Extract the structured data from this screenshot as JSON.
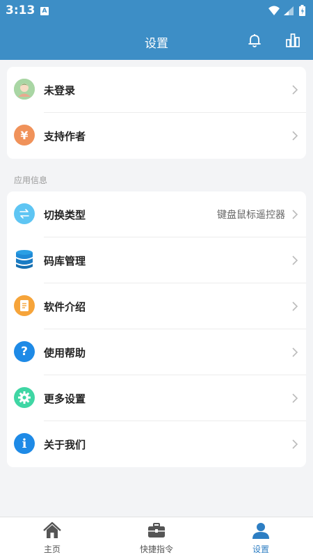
{
  "status_bar": {
    "time": "3:13",
    "notif_letter": "A"
  },
  "app_bar": {
    "title": "设置",
    "icons": [
      "bell-icon",
      "bar-chart-icon"
    ]
  },
  "account_card": [
    {
      "label": "未登录",
      "icon": "avatar-icon"
    },
    {
      "label": "支持作者",
      "icon": "yen-icon",
      "icon_text": "¥",
      "icon_color": "#f0925a"
    }
  ],
  "section_label": "应用信息",
  "app_info_card": [
    {
      "label": "切换类型",
      "value": "键盘鼠标遥控器",
      "icon": "swap-icon",
      "icon_color": "#5ec5f3"
    },
    {
      "label": "码库管理",
      "icon": "database-icon",
      "icon_color": "#1f8ad6"
    },
    {
      "label": "软件介绍",
      "icon": "document-icon",
      "icon_color": "#f6a43a"
    },
    {
      "label": "使用帮助",
      "icon": "help-icon",
      "icon_text": "?",
      "icon_color": "#1e8ae6"
    },
    {
      "label": "更多设置",
      "icon": "gear-icon",
      "icon_color": "#3fd6a4"
    },
    {
      "label": "关于我们",
      "icon": "info-icon",
      "icon_text": "i",
      "icon_color": "#1e8ae6"
    }
  ],
  "tabs": [
    {
      "label": "主页",
      "icon": "home-icon",
      "active": false
    },
    {
      "label": "快捷指令",
      "icon": "toolbox-icon",
      "active": false
    },
    {
      "label": "设置",
      "icon": "user-icon",
      "active": true
    }
  ],
  "colors": {
    "primary": "#3d8ec6",
    "active_tab": "#2d7ec3",
    "background": "#f3f4f6"
  }
}
